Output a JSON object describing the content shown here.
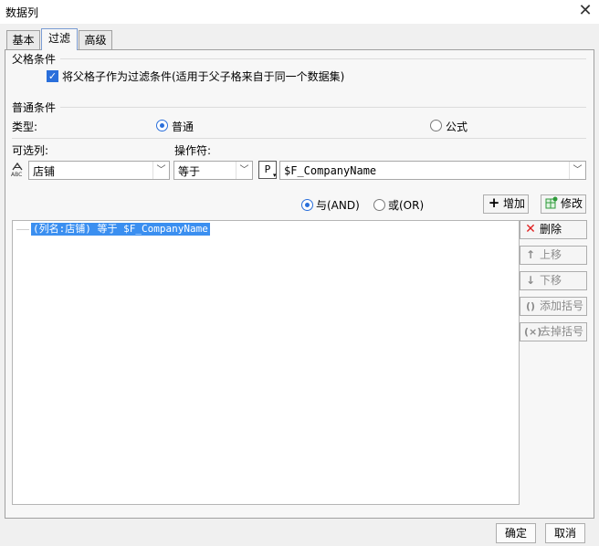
{
  "window": {
    "title": "数据列"
  },
  "tabs": [
    {
      "label": "基本"
    },
    {
      "label": "过滤"
    },
    {
      "label": "高级"
    }
  ],
  "parent_condition": {
    "section_label": "父格条件",
    "checkbox_label": "将父格子作为过滤条件(适用于父子格来自于同一个数据集)",
    "checked": true
  },
  "normal_condition": {
    "section_label": "普通条件",
    "type_label": "类型:",
    "type_options": [
      {
        "label": "普通",
        "selected": true
      },
      {
        "label": "公式",
        "selected": false
      }
    ],
    "column_label": "可选列:",
    "column_value": "店铺",
    "operator_label": "操作符:",
    "operator_value": "等于",
    "value_type_badge": "P",
    "value": "$F_CompanyName"
  },
  "logic": {
    "and_label": "与(AND)",
    "or_label": "或(OR)",
    "selected": "and"
  },
  "actions": {
    "add": "增加",
    "modify": "修改",
    "delete": "删除",
    "move_up": "上移",
    "move_down": "下移",
    "add_bracket": "添加括号",
    "remove_bracket": "去掉括号"
  },
  "conditions": [
    {
      "text": "(列名:店铺) 等于 $F_CompanyName",
      "selected": true
    }
  ],
  "footer": {
    "ok": "确定",
    "cancel": "取消"
  },
  "icons": {
    "column_type": "abc-text-icon",
    "add": "plus-icon",
    "modify": "edit-grid-icon",
    "delete": "red-x-icon",
    "up": "arrow-up-icon",
    "down": "arrow-down-icon",
    "add_bracket": "parentheses-icon",
    "remove_bracket": "parentheses-remove-icon"
  },
  "colors": {
    "accent": "#2a6fdb",
    "selection": "#3b8ff0",
    "delete_red": "#e02020",
    "modify_green": "#2e9a3a"
  }
}
